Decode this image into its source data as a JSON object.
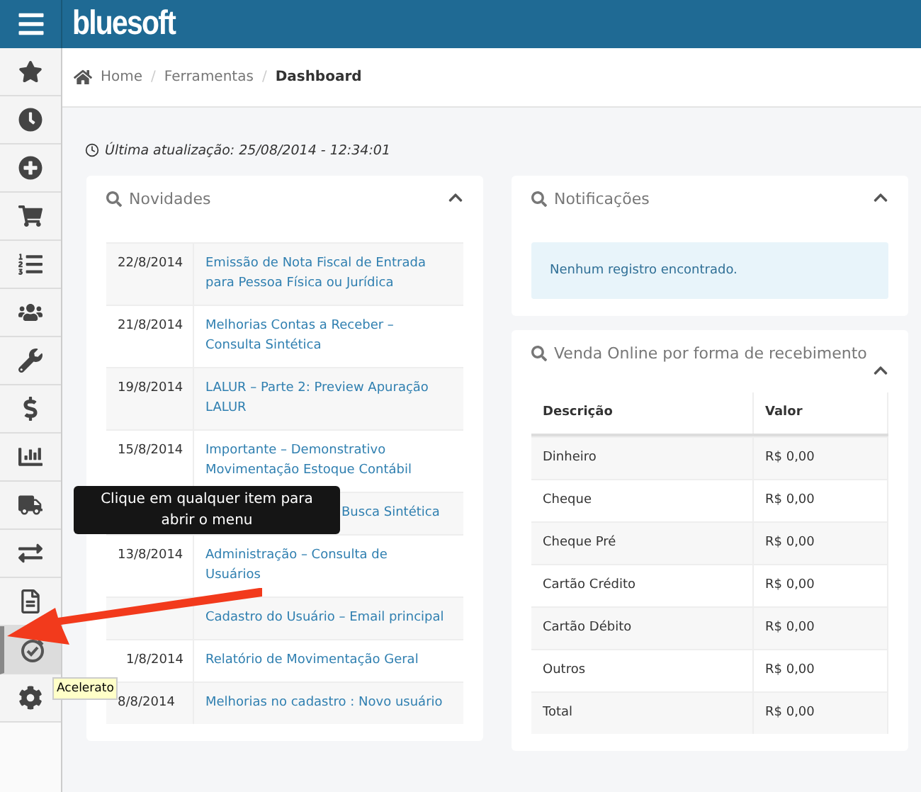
{
  "brand": "bluesoft",
  "sidebar": {
    "items": [
      {
        "kind": "star",
        "selected": false
      },
      {
        "kind": "clock",
        "selected": false
      },
      {
        "kind": "plus",
        "selected": false
      },
      {
        "kind": "cart",
        "selected": false
      },
      {
        "kind": "list",
        "selected": false
      },
      {
        "kind": "users",
        "selected": false
      },
      {
        "kind": "wrench",
        "selected": false
      },
      {
        "kind": "dollar",
        "selected": false
      },
      {
        "kind": "chart",
        "selected": false
      },
      {
        "kind": "truck",
        "selected": false
      },
      {
        "kind": "exchange",
        "selected": false
      },
      {
        "kind": "file",
        "selected": false
      },
      {
        "kind": "gauge",
        "selected": true
      },
      {
        "kind": "gear",
        "selected": false
      }
    ]
  },
  "breadcrumb": [
    "Home",
    "Ferramentas",
    "Dashboard"
  ],
  "breadcrumb_separator": "/",
  "last_update": "Última atualização: 25/08/2014 - 12:34:01",
  "novidades": {
    "title": "Novidades",
    "rows": [
      {
        "date": "22/8/2014",
        "title": "Emissão de Nota Fiscal de Entrada para Pessoa Física ou Jurídica"
      },
      {
        "date": "21/8/2014",
        "title": "Melhorias Contas a Receber – Consulta Sintética"
      },
      {
        "date": "19/8/2014",
        "title": "LALUR – Parte 2: Preview Apuração LALUR"
      },
      {
        "date": "15/8/2014",
        "title": "Importante – Demonstrativo Movimentação Estoque Contábil"
      },
      {
        "title": "Busca Sintética"
      },
      {
        "date": "13/8/2014",
        "title": "Administração – Consulta de Usuários"
      },
      {
        "title": "Cadastro do Usuário – Email principal"
      },
      {
        "date": "1/8/2014",
        "title": "Relatório de Movimentação Geral"
      },
      {
        "date": "8/8/2014",
        "title": "Melhorias no cadastro : Novo usuário"
      }
    ]
  },
  "notificacoes": {
    "title": "Notificações",
    "message": "Nenhum registro encontrado."
  },
  "venda": {
    "title": "Venda Online por forma de recebimento",
    "columns": [
      "Descrição",
      "Valor"
    ],
    "rows": [
      [
        "Dinheiro",
        "R$ 0,00"
      ],
      [
        "Cheque",
        "R$ 0,00"
      ],
      [
        "Cheque Pré",
        "R$ 0,00"
      ],
      [
        "Cartão Crédito",
        "R$ 0,00"
      ],
      [
        "Cartão Débito",
        "R$ 0,00"
      ],
      [
        "Outros",
        "R$ 0,00"
      ],
      [
        "Total",
        "R$ 0,00"
      ]
    ]
  },
  "tooltip": "Clique em qualquer item para abrir o menu",
  "hover_tip": "Acelerato"
}
